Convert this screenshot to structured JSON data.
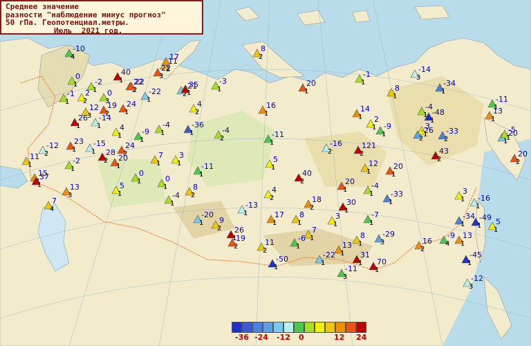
{
  "title": {
    "line1": "Среднее значение",
    "line2": "разности \"наблюдение минус прогноз\"",
    "line3": "50 гПа. Геопотенциал.метры.",
    "line4": "Июль  2021 год."
  },
  "legend": {
    "colors": [
      "#2030c8",
      "#3a5ad8",
      "#4a80e0",
      "#5aa0e8",
      "#78c8f0",
      "#b8f0f0",
      "#4cc84c",
      "#a8e020",
      "#f0f000",
      "#f0c800",
      "#f09000",
      "#f05010",
      "#c00000"
    ],
    "labels": [
      "-36",
      "-24",
      "-12",
      "0",
      "12",
      "24"
    ]
  },
  "stations": [
    {
      "v": "-10",
      "n": "4"
    },
    {
      "v": "8",
      "n": "2"
    },
    {
      "v": "11",
      "n": "2"
    },
    {
      "v": "17",
      "n": ""
    },
    {
      "v": "0",
      "n": "1"
    },
    {
      "v": "40",
      "n": "1"
    },
    {
      "v": "22",
      "n": "3"
    },
    {
      "v": "22",
      "n": "3"
    },
    {
      "v": "-1",
      "n": "1"
    },
    {
      "v": "-2",
      "n": "1"
    },
    {
      "v": "2",
      "n": "2"
    },
    {
      "v": "0",
      "n": "3"
    },
    {
      "v": "22",
      "n": "2"
    },
    {
      "v": "-21",
      "n": "2"
    },
    {
      "v": "35",
      "n": "1"
    },
    {
      "v": "-3",
      "n": "1"
    },
    {
      "v": "-22",
      "n": "1"
    },
    {
      "v": "12",
      "n": "3"
    },
    {
      "v": "19",
      "n": "2"
    },
    {
      "v": "24",
      "n": "1"
    },
    {
      "v": "4",
      "n": "2"
    },
    {
      "v": "26",
      "n": "1"
    },
    {
      "v": "-14",
      "n": "1"
    },
    {
      "v": "20",
      "n": "1"
    },
    {
      "v": "-1",
      "n": "1"
    },
    {
      "v": "-14",
      "n": "3"
    },
    {
      "v": "8",
      "n": "1"
    },
    {
      "v": "-34",
      "n": "1"
    },
    {
      "v": "-11",
      "n": "1"
    },
    {
      "v": "16",
      "n": "1"
    },
    {
      "v": "14",
      "n": "1"
    },
    {
      "v": "-4",
      "n": "1"
    },
    {
      "v": "-48",
      "n": "1"
    },
    {
      "v": "13",
      "n": "1"
    },
    {
      "v": "2",
      "n": "1"
    },
    {
      "v": "3",
      "n": "1"
    },
    {
      "v": "4",
      "n": "1"
    },
    {
      "v": "-9",
      "n": "1"
    },
    {
      "v": "-4",
      "n": "1"
    },
    {
      "v": "-36",
      "n": "1"
    },
    {
      "v": "-4",
      "n": "2"
    },
    {
      "v": "-11",
      "n": "1"
    },
    {
      "v": "-9",
      "n": "1"
    },
    {
      "v": "-26",
      "n": "2"
    },
    {
      "v": "-33",
      "n": "2"
    },
    {
      "v": "-20",
      "n": "1"
    },
    {
      "v": "-5",
      "n": "1"
    },
    {
      "v": "23",
      "n": "1"
    },
    {
      "v": "-12",
      "n": "2"
    },
    {
      "v": "-15",
      "n": "1"
    },
    {
      "v": "24",
      "n": "2"
    },
    {
      "v": "28",
      "n": "2"
    },
    {
      "v": "11",
      "n": "1"
    },
    {
      "v": "-2",
      "n": "1"
    },
    {
      "v": "20",
      "n": "1"
    },
    {
      "v": "7",
      "n": "1"
    },
    {
      "v": "3",
      "n": "1"
    },
    {
      "v": "-16",
      "n": "2"
    },
    {
      "v": "121",
      "n": "2"
    },
    {
      "v": "43",
      "n": "2"
    },
    {
      "v": "20",
      "n": "2"
    },
    {
      "v": "15",
      "n": "1"
    },
    {
      "v": "0",
      "n": "1"
    },
    {
      "v": "-11",
      "n": "1"
    },
    {
      "v": "5",
      "n": "1"
    },
    {
      "v": "12",
      "n": "1"
    },
    {
      "v": "20",
      "n": "1"
    },
    {
      "v": "37",
      "n": "1"
    },
    {
      "v": "5",
      "n": "1"
    },
    {
      "v": "0",
      "n": "1"
    },
    {
      "v": "40",
      "n": "2"
    },
    {
      "v": "20",
      "n": "1"
    },
    {
      "v": "-4",
      "n": "1"
    },
    {
      "v": "-33",
      "n": "1"
    },
    {
      "v": "3",
      "n": "1"
    },
    {
      "v": "-16",
      "n": "1"
    },
    {
      "v": "13",
      "n": "3"
    },
    {
      "v": "8",
      "n": "2"
    },
    {
      "v": "4",
      "n": "2"
    },
    {
      "v": "18",
      "n": "2"
    },
    {
      "v": "30",
      "n": "1"
    },
    {
      "v": "7",
      "n": "4"
    },
    {
      "v": "-4",
      "n": "1"
    },
    {
      "v": "-13",
      "n": "1"
    },
    {
      "v": "17",
      "n": "1"
    },
    {
      "v": "8",
      "n": "1"
    },
    {
      "v": "3",
      "n": "1"
    },
    {
      "v": "-7",
      "n": "1"
    },
    {
      "v": "-34",
      "n": "1"
    },
    {
      "v": "-49",
      "n": "1"
    },
    {
      "v": "5",
      "n": "1"
    },
    {
      "v": "-20",
      "n": "1"
    },
    {
      "v": "9",
      "n": "2"
    },
    {
      "v": "26",
      "n": "1"
    },
    {
      "v": "19",
      "n": "2"
    },
    {
      "v": "7",
      "n": "1"
    },
    {
      "v": "8",
      "n": "1"
    },
    {
      "v": "-29",
      "n": "3"
    },
    {
      "v": "16",
      "n": "2"
    },
    {
      "v": "-9",
      "n": "4"
    },
    {
      "v": "13",
      "n": "1"
    },
    {
      "v": "11",
      "n": "2"
    },
    {
      "v": "-6",
      "n": "1"
    },
    {
      "v": "13",
      "n": "1"
    },
    {
      "v": "-22",
      "n": "1"
    },
    {
      "v": "31",
      "n": "1"
    },
    {
      "v": "70",
      "n": "1"
    },
    {
      "v": "-45",
      "n": "1"
    },
    {
      "v": "-50",
      "n": "1"
    },
    {
      "v": "-11",
      "n": "3"
    },
    {
      "v": "-12",
      "n": "3"
    },
    {
      "v": "11",
      "n": "1"
    }
  ]
}
